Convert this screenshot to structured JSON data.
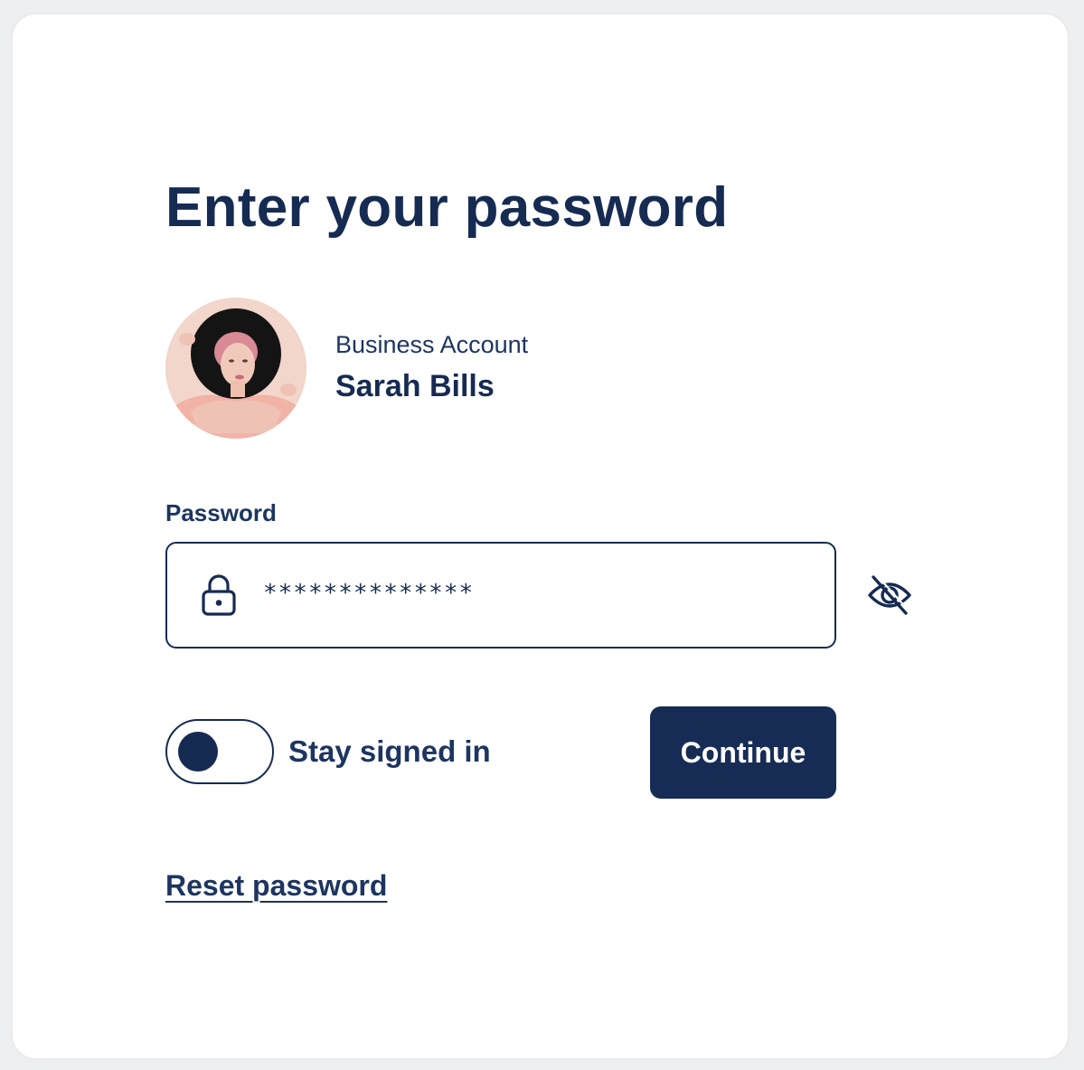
{
  "page": {
    "title": "Enter your password"
  },
  "account": {
    "type": "Business Account",
    "name": "Sarah Bills",
    "avatar_alt": "Sarah Bills profile photo"
  },
  "password": {
    "label": "Password",
    "value": "**************",
    "lock_icon": "lock-icon",
    "visibility_icon": "eye-slash-icon"
  },
  "stay_signed_in": {
    "label": "Stay signed in",
    "enabled": false
  },
  "actions": {
    "continue_label": "Continue",
    "reset_label": "Reset password"
  },
  "colors": {
    "primary": "#162b52",
    "background": "#eeeff1",
    "card": "#ffffff"
  }
}
